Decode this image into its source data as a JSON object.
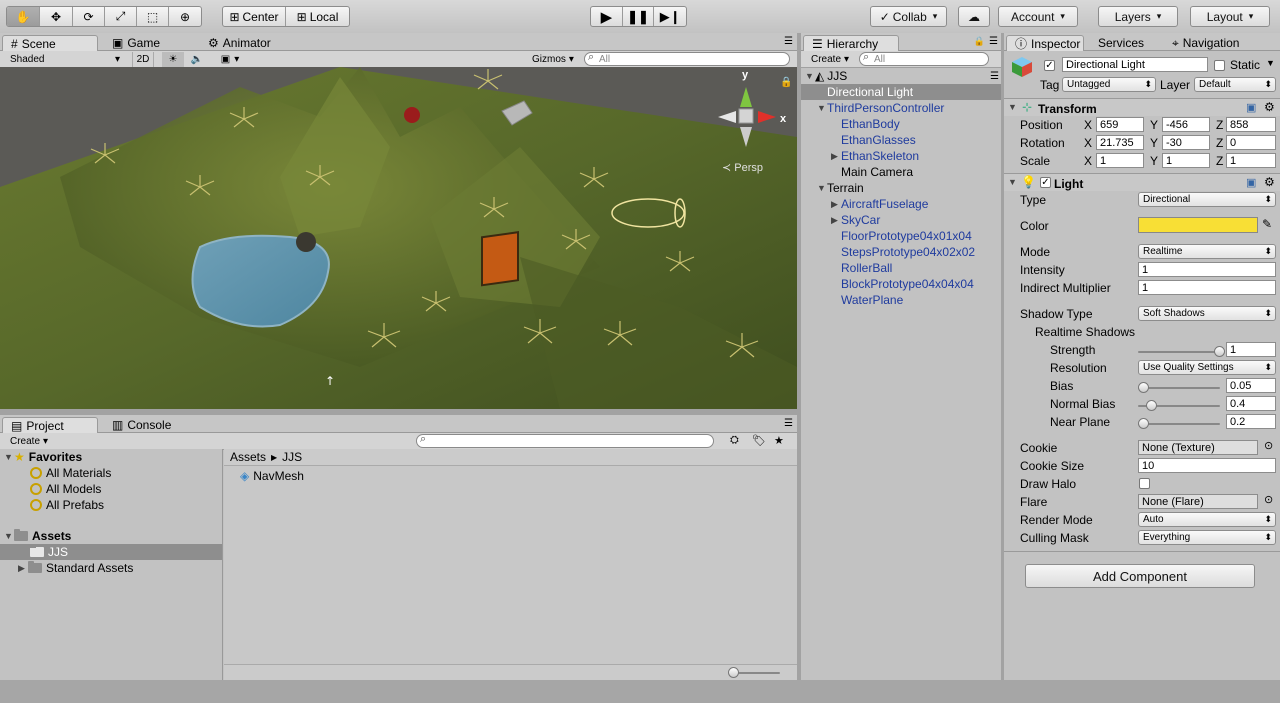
{
  "toolbar": {
    "tools": [
      "hand-icon",
      "move-icon",
      "rotate-icon",
      "scale-icon",
      "rect-icon",
      "transform-icon"
    ],
    "pivot": "Center",
    "space": "Local",
    "collab": "Collab",
    "account": "Account",
    "layers": "Layers",
    "layout": "Layout"
  },
  "scene_panel": {
    "tabs": [
      "Scene",
      "Game",
      "Animator"
    ],
    "shading": "Shaded",
    "mode_2d": "2D",
    "gizmos": "Gizmos",
    "search_placeholder": "All",
    "persp_label": "Persp",
    "axis_x": "x",
    "axis_y": "y"
  },
  "hierarchy": {
    "tab": "Hierarchy",
    "create": "Create",
    "search_placeholder": "All",
    "scene_name": "JJS",
    "items": [
      {
        "label": "Directional Light",
        "depth": 0,
        "arrow": "",
        "selected": true,
        "color": "black"
      },
      {
        "label": "ThirdPersonController",
        "depth": 0,
        "arrow": "open",
        "color": "blue"
      },
      {
        "label": "EthanBody",
        "depth": 1,
        "arrow": "",
        "color": "blue"
      },
      {
        "label": "EthanGlasses",
        "depth": 1,
        "arrow": "",
        "color": "blue"
      },
      {
        "label": "EthanSkeleton",
        "depth": 1,
        "arrow": "closed",
        "color": "blue"
      },
      {
        "label": "Main Camera",
        "depth": 1,
        "arrow": "",
        "color": "black"
      },
      {
        "label": "Terrain",
        "depth": 0,
        "arrow": "open",
        "color": "black"
      },
      {
        "label": "AircraftFuselage",
        "depth": 1,
        "arrow": "closed",
        "color": "blue"
      },
      {
        "label": "SkyCar",
        "depth": 1,
        "arrow": "closed",
        "color": "blue"
      },
      {
        "label": "FloorPrototype04x01x04",
        "depth": 1,
        "arrow": "",
        "color": "blue"
      },
      {
        "label": "StepsPrototype04x02x02",
        "depth": 1,
        "arrow": "",
        "color": "blue"
      },
      {
        "label": "RollerBall",
        "depth": 1,
        "arrow": "",
        "color": "blue"
      },
      {
        "label": "BlockPrototype04x04x04",
        "depth": 1,
        "arrow": "",
        "color": "blue"
      },
      {
        "label": "WaterPlane",
        "depth": 1,
        "arrow": "",
        "color": "blue"
      }
    ]
  },
  "inspector": {
    "tabs": [
      "Inspector",
      "Services",
      "Navigation"
    ],
    "object_name": "Directional Light",
    "static_label": "Static",
    "tag_label": "Tag",
    "tag_value": "Untagged",
    "layer_label": "Layer",
    "layer_value": "Default",
    "transform": {
      "title": "Transform",
      "position": {
        "label": "Position",
        "x": "659",
        "y": "-456",
        "z": "858"
      },
      "rotation": {
        "label": "Rotation",
        "x": "21.735",
        "y": "-30",
        "z": "0"
      },
      "scale": {
        "label": "Scale",
        "x": "1",
        "y": "1",
        "z": "1"
      }
    },
    "light": {
      "title": "Light",
      "type_label": "Type",
      "type_value": "Directional",
      "color_label": "Color",
      "color_hex": "#f8df35",
      "mode_label": "Mode",
      "mode_value": "Realtime",
      "intensity_label": "Intensity",
      "intensity_value": "1",
      "indirect_label": "Indirect Multiplier",
      "indirect_value": "1",
      "shadow_type_label": "Shadow Type",
      "shadow_type_value": "Soft Shadows",
      "realtime_shadows_label": "Realtime Shadows",
      "strength_label": "Strength",
      "strength_value": "1",
      "resolution_label": "Resolution",
      "resolution_value": "Use Quality Settings",
      "bias_label": "Bias",
      "bias_value": "0.05",
      "normal_bias_label": "Normal Bias",
      "normal_bias_value": "0.4",
      "near_plane_label": "Near Plane",
      "near_plane_value": "0.2",
      "cookie_label": "Cookie",
      "cookie_value": "None (Texture)",
      "cookie_size_label": "Cookie Size",
      "cookie_size_value": "10",
      "draw_halo_label": "Draw Halo",
      "flare_label": "Flare",
      "flare_value": "None (Flare)",
      "render_mode_label": "Render Mode",
      "render_mode_value": "Auto",
      "culling_label": "Culling Mask",
      "culling_value": "Everything"
    },
    "add_component": "Add Component"
  },
  "project": {
    "tabs": [
      "Project",
      "Console"
    ],
    "create": "Create",
    "favorites_label": "Favorites",
    "favorites": [
      "All Materials",
      "All Models",
      "All Prefabs"
    ],
    "assets_label": "Assets",
    "asset_folders": [
      "JJS",
      "Standard Assets"
    ],
    "breadcrumb": [
      "Assets",
      "JJS"
    ],
    "files": [
      "NavMesh"
    ]
  }
}
